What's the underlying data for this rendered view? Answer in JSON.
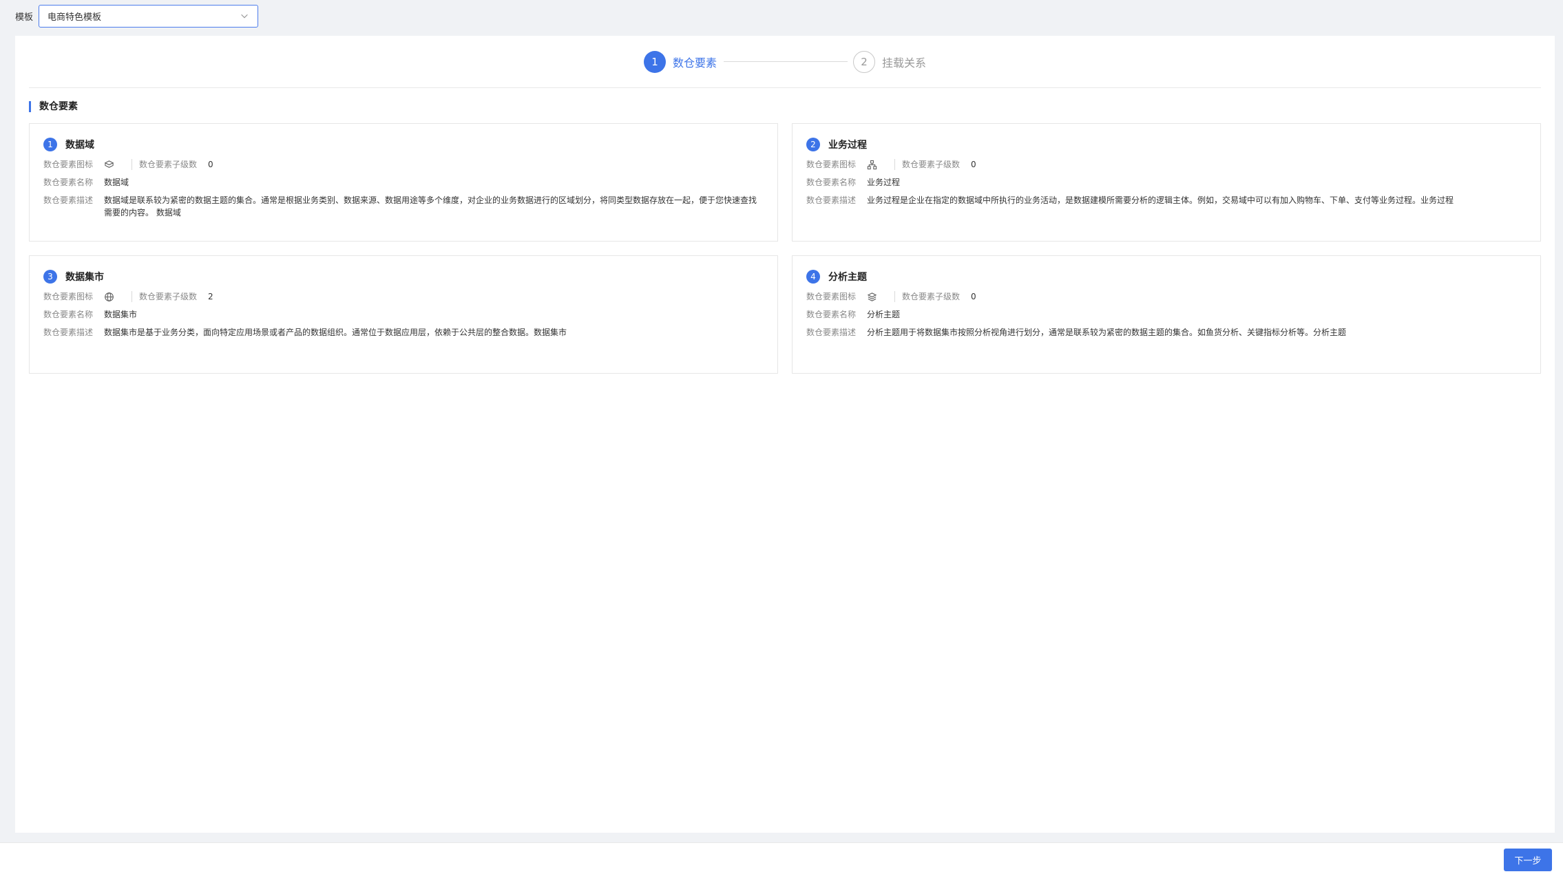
{
  "topbar": {
    "template_label": "模板",
    "template_value": "电商特色模板"
  },
  "steps": [
    {
      "number": "1",
      "label": "数仓要素",
      "state": "active"
    },
    {
      "number": "2",
      "label": "挂载关系",
      "state": "inactive"
    }
  ],
  "section_title": "数仓要素",
  "field_labels": {
    "icon": "数仓要素图标",
    "child_level": "数仓要素子级数",
    "name": "数仓要素名称",
    "desc": "数仓要素描述"
  },
  "cards": [
    {
      "number": "1",
      "title": "数据域",
      "icon": "cube-icon",
      "child_level": "0",
      "name": "数据域",
      "desc": "数据域是联系较为紧密的数据主题的集合。通常是根据业务类别、数据来源、数据用途等多个维度，对企业的业务数据进行的区域划分，将同类型数据存放在一起，便于您快速查找需要的内容。 数据域"
    },
    {
      "number": "2",
      "title": "业务过程",
      "icon": "hierarchy-icon",
      "child_level": "0",
      "name": "业务过程",
      "desc": "业务过程是企业在指定的数据域中所执行的业务活动，是数据建模所需要分析的逻辑主体。例如，交易域中可以有加入购物车、下单、支付等业务过程。业务过程"
    },
    {
      "number": "3",
      "title": "数据集市",
      "icon": "globe-icon",
      "child_level": "2",
      "name": "数据集市",
      "desc": "数据集市是基于业务分类，面向特定应用场景或者产品的数据组织。通常位于数据应用层，依赖于公共层的整合数据。数据集市"
    },
    {
      "number": "4",
      "title": "分析主题",
      "icon": "layers-icon",
      "child_level": "0",
      "name": "分析主题",
      "desc": "分析主题用于将数据集市按照分析视角进行划分，通常是联系较为紧密的数据主题的集合。如鱼货分析、关键指标分析等。分析主题"
    }
  ],
  "footer": {
    "next_label": "下一步"
  },
  "colors": {
    "accent": "#3d74e8",
    "background": "#f0f2f5"
  }
}
